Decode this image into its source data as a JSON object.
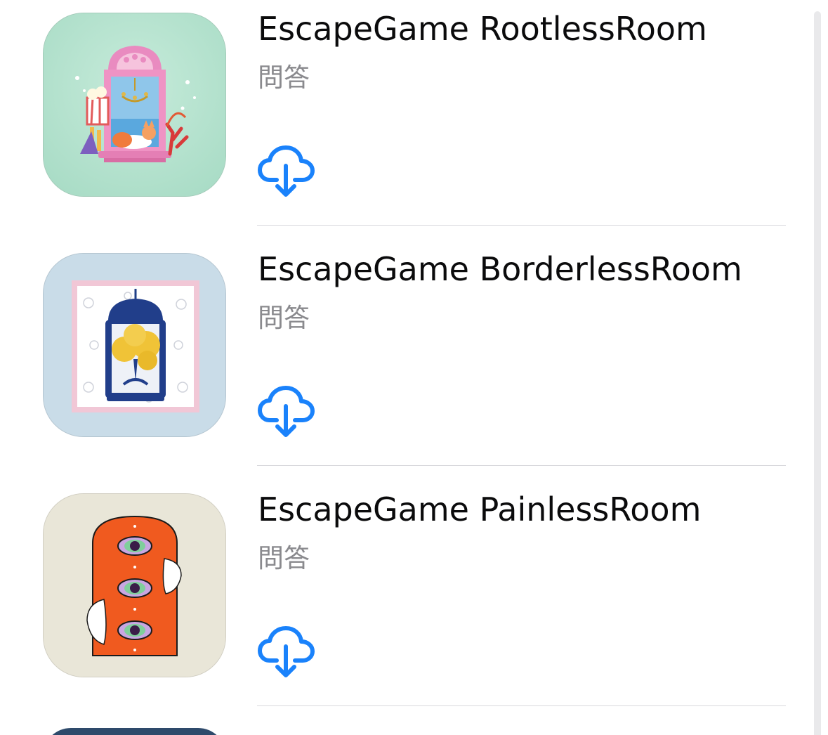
{
  "apps": [
    {
      "title": "EscapeGame RootlessRoom",
      "category": "問答",
      "icon": "rootless-room-icon",
      "icon_bg": "#b6e3cf"
    },
    {
      "title": "EscapeGame BorderlessRoom",
      "category": "問答",
      "icon": "borderless-room-icon",
      "icon_bg": "#c9dce8"
    },
    {
      "title": "EscapeGame PainlessRoom",
      "category": "問答",
      "icon": "painless-room-icon",
      "icon_bg": "#e9e6d8"
    }
  ],
  "download_icon": "cloud-download-icon",
  "accent_color": "#1a82fb"
}
